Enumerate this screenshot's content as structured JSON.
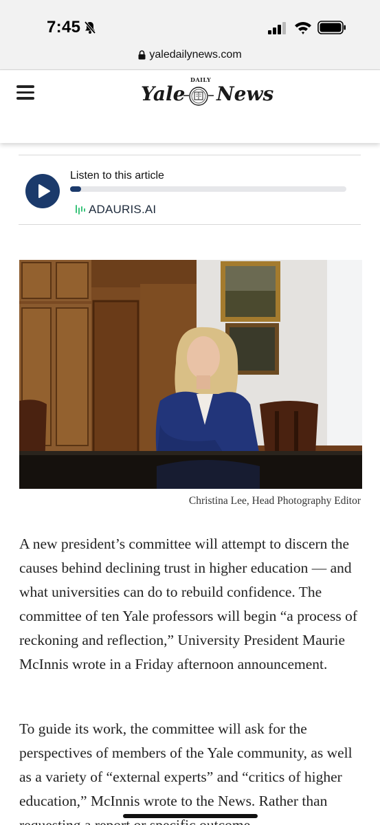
{
  "status_bar": {
    "time": "7:45"
  },
  "browser": {
    "url": "yaledailynews.com"
  },
  "header": {
    "logo_left": "Yale",
    "logo_top": "DAILY",
    "logo_right": "News"
  },
  "audio_player": {
    "label": "Listen to this article",
    "progress_percent": 4,
    "brand": "ADAURIS.AI"
  },
  "photo": {
    "caption": "Christina Lee, Head Photography Editor"
  },
  "article": {
    "paragraphs": [
      "A new president’s committee will attempt to discern the causes behind declining trust in higher education — and what universities can do to rebuild confidence. The committee of ten Yale professors will begin “a process of reckoning and reflection,” University President Maurie McInnis wrote in a Friday afternoon announcement.",
      "To guide its work, the committee will ask for the perspectives of members of the Yale community, as well as a variety of “external experts” and “critics of higher education,” McInnis wrote to the News. Rather than requesting a report or specific outcome"
    ]
  },
  "colors": {
    "accent": "#1b3a6b",
    "brand_green": "#3cc47c"
  }
}
